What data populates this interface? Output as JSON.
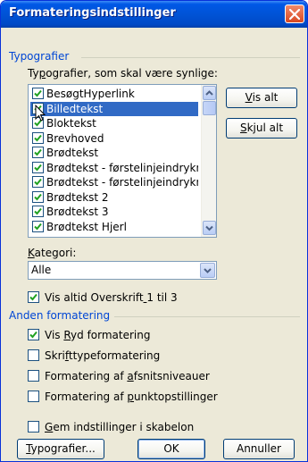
{
  "window": {
    "title": "Formateringsindstillinger"
  },
  "styles_section": {
    "header": "Typografier",
    "list_label": "Typografier, som skal være synlige:",
    "items": [
      {
        "label": "BesøgtHyperlink",
        "checked": true,
        "selected": false
      },
      {
        "label": "Billedtekst",
        "checked": true,
        "selected": true
      },
      {
        "label": "Bloktekst",
        "checked": true,
        "selected": false
      },
      {
        "label": "Brevhoved",
        "checked": true,
        "selected": false
      },
      {
        "label": "Brødtekst",
        "checked": true,
        "selected": false
      },
      {
        "label": "Brødtekst - førstelinjeindrykn",
        "checked": true,
        "selected": false
      },
      {
        "label": "Brødtekst - førstelinjeindrykn",
        "checked": true,
        "selected": false
      },
      {
        "label": "Brødtekst 2",
        "checked": true,
        "selected": false
      },
      {
        "label": "Brødtekst 3",
        "checked": true,
        "selected": false
      },
      {
        "label": "Brødtekst Hjerl",
        "checked": true,
        "selected": false
      }
    ],
    "show_all_button": "Vis alt",
    "hide_all_button": "Skjul alt",
    "category_label": "Kategori:",
    "category_value": "Alle",
    "show_headings_label": "Vis altid Overskrift 1 til 3",
    "show_headings_checked": true
  },
  "other_section": {
    "header": "Anden formatering",
    "options": [
      {
        "label": "Vis Ryd formatering",
        "checked": true
      },
      {
        "label": "Skrifttypeformatering",
        "checked": false
      },
      {
        "label": "Formatering af afsnitsniveauer",
        "checked": false
      },
      {
        "label": "Formatering af punktopstillinger",
        "checked": false
      }
    ]
  },
  "save_in_template_label": "Gem indstillinger i skabelon",
  "save_in_template_checked": false,
  "buttons": {
    "styles": "Typografier...",
    "ok": "OK",
    "cancel": "Annuller"
  },
  "icons": {
    "close": "close-icon",
    "check": "checkmark-icon",
    "scroll_up": "chevron-up-icon",
    "scroll_down": "chevron-down-icon",
    "dropdown": "chevron-down-icon",
    "cursor": "mouse-pointer-icon"
  },
  "colors": {
    "titlebar": "#0054e3",
    "dialog_bg": "#ece9d8",
    "section_header": "#0046d5",
    "selection": "#316ac5",
    "close_button": "#d94820"
  }
}
